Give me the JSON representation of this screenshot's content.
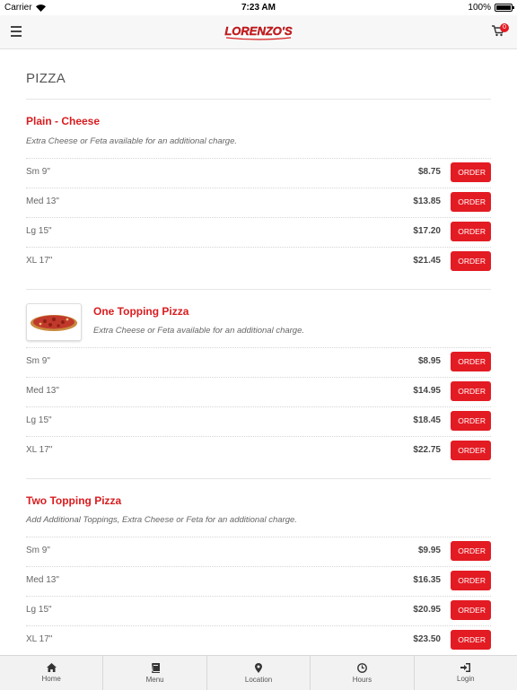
{
  "status_bar": {
    "carrier": "Carrier",
    "time": "7:23 AM",
    "battery": "100%"
  },
  "header": {
    "logo_text": "LORENZO'S",
    "cart_count": "0"
  },
  "page": {
    "title": "PIZZA"
  },
  "sections": [
    {
      "title": "Plain - Cheese",
      "description": "Extra Cheese or Feta available for an additional charge.",
      "has_image": false,
      "items": [
        {
          "size": "Sm 9\"",
          "price": "$8.75",
          "button": "ORDER"
        },
        {
          "size": "Med 13\"",
          "price": "$13.85",
          "button": "ORDER"
        },
        {
          "size": "Lg 15\"",
          "price": "$17.20",
          "button": "ORDER"
        },
        {
          "size": "XL 17\"",
          "price": "$21.45",
          "button": "ORDER"
        }
      ]
    },
    {
      "title": "One Topping Pizza",
      "description": "Extra Cheese or Feta available for an additional charge.",
      "has_image": true,
      "items": [
        {
          "size": "Sm 9\"",
          "price": "$8.95",
          "button": "ORDER"
        },
        {
          "size": "Med 13\"",
          "price": "$14.95",
          "button": "ORDER"
        },
        {
          "size": "Lg 15\"",
          "price": "$18.45",
          "button": "ORDER"
        },
        {
          "size": "XL 17\"",
          "price": "$22.75",
          "button": "ORDER"
        }
      ]
    },
    {
      "title": "Two Topping Pizza",
      "description": "Add Additional Toppings, Extra Cheese or Feta for an additional charge.",
      "has_image": false,
      "items": [
        {
          "size": "Sm 9\"",
          "price": "$9.95",
          "button": "ORDER"
        },
        {
          "size": "Med 13\"",
          "price": "$16.35",
          "button": "ORDER"
        },
        {
          "size": "Lg 15\"",
          "price": "$20.95",
          "button": "ORDER"
        },
        {
          "size": "XL 17\"",
          "price": "$23.50",
          "button": "ORDER"
        }
      ]
    }
  ],
  "tab_bar": [
    {
      "label": "Home",
      "icon": "home-icon"
    },
    {
      "label": "Menu",
      "icon": "book-icon"
    },
    {
      "label": "Location",
      "icon": "map-pin-icon"
    },
    {
      "label": "Hours",
      "icon": "clock-icon"
    },
    {
      "label": "Login",
      "icon": "login-icon"
    }
  ],
  "colors": {
    "accent": "#e31b23",
    "title_red": "#d91c1f",
    "tab_bg": "#f2f2f2"
  }
}
